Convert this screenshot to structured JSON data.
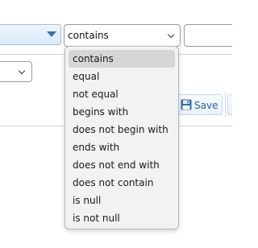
{
  "filter_row": {
    "operator_value": "contains",
    "value_input": ""
  },
  "save_button": {
    "label": "Save",
    "icon": "floppy-disk-icon"
  },
  "operator_options": [
    "contains",
    "equal",
    "not equal",
    "begins with",
    "does not begin with",
    "ends with",
    "does not end with",
    "does not contain",
    "is null",
    "is not null"
  ],
  "selected_option_index": 0,
  "colors": {
    "field_select_border": "#9dbbdc",
    "field_select_arrow": "#3a72b0",
    "save_text": "#1f5f9e",
    "highlight": "#d6d6d6"
  }
}
